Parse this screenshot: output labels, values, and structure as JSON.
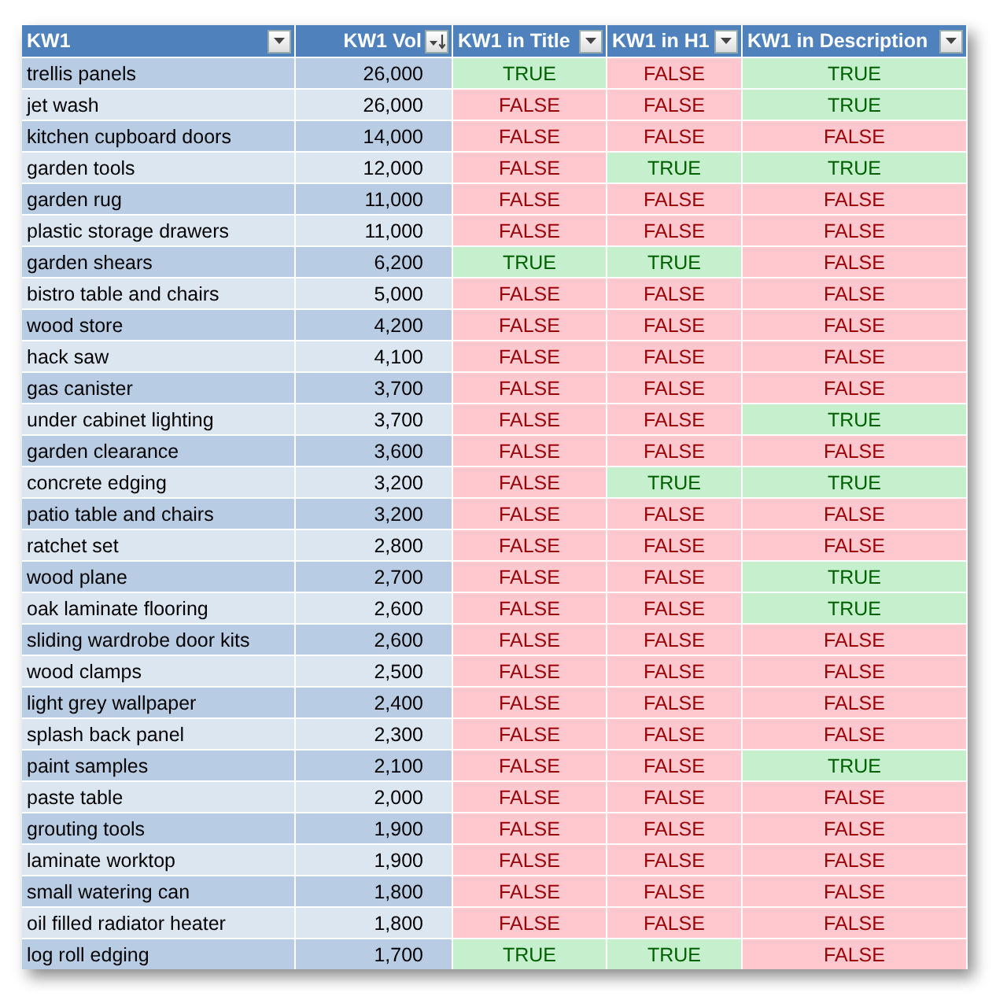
{
  "table": {
    "columns": [
      {
        "label": "KW1",
        "kind": "filter"
      },
      {
        "label": "KW1 Vol",
        "kind": "sorted"
      },
      {
        "label": "KW1 in Title",
        "kind": "filter"
      },
      {
        "label": "KW1 in H1",
        "kind": "filter"
      },
      {
        "label": "KW1 in Description",
        "kind": "filter"
      }
    ],
    "rows": [
      {
        "kw": "trellis panels",
        "vol": "26,000",
        "checks": [
          {
            "text": "TRUE",
            "match": true
          },
          {
            "text": "FALSE",
            "match": false
          },
          {
            "text": "TRUE",
            "match": true
          }
        ]
      },
      {
        "kw": "jet wash",
        "vol": "26,000",
        "checks": [
          {
            "text": "FALSE",
            "match": false
          },
          {
            "text": "FALSE",
            "match": false
          },
          {
            "text": "TRUE",
            "match": true
          }
        ]
      },
      {
        "kw": "kitchen cupboard doors",
        "vol": "14,000",
        "checks": [
          {
            "text": "FALSE",
            "match": false
          },
          {
            "text": "FALSE",
            "match": false
          },
          {
            "text": "FALSE",
            "match": false
          }
        ]
      },
      {
        "kw": "garden tools",
        "vol": "12,000",
        "checks": [
          {
            "text": "FALSE",
            "match": false
          },
          {
            "text": "TRUE",
            "match": true
          },
          {
            "text": "TRUE",
            "match": true
          }
        ]
      },
      {
        "kw": "garden rug",
        "vol": "11,000",
        "checks": [
          {
            "text": "FALSE",
            "match": false
          },
          {
            "text": "FALSE",
            "match": false
          },
          {
            "text": "FALSE",
            "match": false
          }
        ]
      },
      {
        "kw": "plastic storage drawers",
        "vol": "11,000",
        "checks": [
          {
            "text": "FALSE",
            "match": false
          },
          {
            "text": "FALSE",
            "match": false
          },
          {
            "text": "FALSE",
            "match": false
          }
        ]
      },
      {
        "kw": "garden shears",
        "vol": "6,200",
        "checks": [
          {
            "text": "TRUE",
            "match": true
          },
          {
            "text": "TRUE",
            "match": true
          },
          {
            "text": "FALSE",
            "match": false
          }
        ]
      },
      {
        "kw": "bistro table and chairs",
        "vol": "5,000",
        "checks": [
          {
            "text": "FALSE",
            "match": false
          },
          {
            "text": "FALSE",
            "match": false
          },
          {
            "text": "FALSE",
            "match": false
          }
        ]
      },
      {
        "kw": "wood store",
        "vol": "4,200",
        "checks": [
          {
            "text": "FALSE",
            "match": false
          },
          {
            "text": "FALSE",
            "match": false
          },
          {
            "text": "FALSE",
            "match": false
          }
        ]
      },
      {
        "kw": "hack saw",
        "vol": "4,100",
        "checks": [
          {
            "text": "FALSE",
            "match": false
          },
          {
            "text": "FALSE",
            "match": false
          },
          {
            "text": "FALSE",
            "match": false
          }
        ]
      },
      {
        "kw": "gas canister",
        "vol": "3,700",
        "checks": [
          {
            "text": "FALSE",
            "match": false
          },
          {
            "text": "FALSE",
            "match": false
          },
          {
            "text": "FALSE",
            "match": false
          }
        ]
      },
      {
        "kw": "under cabinet lighting",
        "vol": "3,700",
        "checks": [
          {
            "text": "FALSE",
            "match": false
          },
          {
            "text": "FALSE",
            "match": false
          },
          {
            "text": "TRUE",
            "match": true
          }
        ]
      },
      {
        "kw": "garden clearance",
        "vol": "3,600",
        "checks": [
          {
            "text": "FALSE",
            "match": false
          },
          {
            "text": "FALSE",
            "match": false
          },
          {
            "text": "FALSE",
            "match": false
          }
        ]
      },
      {
        "kw": "concrete edging",
        "vol": "3,200",
        "checks": [
          {
            "text": "FALSE",
            "match": false
          },
          {
            "text": "TRUE",
            "match": true
          },
          {
            "text": "TRUE",
            "match": true
          }
        ]
      },
      {
        "kw": "patio table and chairs",
        "vol": "3,200",
        "checks": [
          {
            "text": "FALSE",
            "match": false
          },
          {
            "text": "FALSE",
            "match": false
          },
          {
            "text": "FALSE",
            "match": false
          }
        ]
      },
      {
        "kw": "ratchet set",
        "vol": "2,800",
        "checks": [
          {
            "text": "FALSE",
            "match": false
          },
          {
            "text": "FALSE",
            "match": false
          },
          {
            "text": "FALSE",
            "match": false
          }
        ]
      },
      {
        "kw": "wood plane",
        "vol": "2,700",
        "checks": [
          {
            "text": "FALSE",
            "match": false
          },
          {
            "text": "FALSE",
            "match": false
          },
          {
            "text": "TRUE",
            "match": true
          }
        ]
      },
      {
        "kw": "oak laminate flooring",
        "vol": "2,600",
        "checks": [
          {
            "text": "FALSE",
            "match": false
          },
          {
            "text": "FALSE",
            "match": false
          },
          {
            "text": "TRUE",
            "match": true
          }
        ]
      },
      {
        "kw": "sliding wardrobe door kits",
        "vol": "2,600",
        "checks": [
          {
            "text": "FALSE",
            "match": false
          },
          {
            "text": "FALSE",
            "match": false
          },
          {
            "text": "FALSE",
            "match": false
          }
        ]
      },
      {
        "kw": "wood clamps",
        "vol": "2,500",
        "checks": [
          {
            "text": "FALSE",
            "match": false
          },
          {
            "text": "FALSE",
            "match": false
          },
          {
            "text": "FALSE",
            "match": false
          }
        ]
      },
      {
        "kw": "light grey wallpaper",
        "vol": "2,400",
        "checks": [
          {
            "text": "FALSE",
            "match": false
          },
          {
            "text": "FALSE",
            "match": false
          },
          {
            "text": "FALSE",
            "match": false
          }
        ]
      },
      {
        "kw": "splash back panel",
        "vol": "2,300",
        "checks": [
          {
            "text": "FALSE",
            "match": false
          },
          {
            "text": "FALSE",
            "match": false
          },
          {
            "text": "FALSE",
            "match": false
          }
        ]
      },
      {
        "kw": "paint samples",
        "vol": "2,100",
        "checks": [
          {
            "text": "FALSE",
            "match": false
          },
          {
            "text": "FALSE",
            "match": false
          },
          {
            "text": "TRUE",
            "match": true
          }
        ]
      },
      {
        "kw": "paste table",
        "vol": "2,000",
        "checks": [
          {
            "text": "FALSE",
            "match": false
          },
          {
            "text": "FALSE",
            "match": false
          },
          {
            "text": "FALSE",
            "match": false
          }
        ]
      },
      {
        "kw": "grouting tools",
        "vol": "1,900",
        "checks": [
          {
            "text": "FALSE",
            "match": false
          },
          {
            "text": "FALSE",
            "match": false
          },
          {
            "text": "FALSE",
            "match": false
          }
        ]
      },
      {
        "kw": "laminate worktop",
        "vol": "1,900",
        "checks": [
          {
            "text": "FALSE",
            "match": false
          },
          {
            "text": "FALSE",
            "match": false
          },
          {
            "text": "FALSE",
            "match": false
          }
        ]
      },
      {
        "kw": "small watering can",
        "vol": "1,800",
        "checks": [
          {
            "text": "FALSE",
            "match": false
          },
          {
            "text": "FALSE",
            "match": false
          },
          {
            "text": "FALSE",
            "match": false
          }
        ]
      },
      {
        "kw": "oil filled radiator heater",
        "vol": "1,800",
        "checks": [
          {
            "text": "FALSE",
            "match": false
          },
          {
            "text": "FALSE",
            "match": false
          },
          {
            "text": "FALSE",
            "match": false
          }
        ]
      },
      {
        "kw": "log roll edging",
        "vol": "1,700",
        "checks": [
          {
            "text": "TRUE",
            "match": true
          },
          {
            "text": "TRUE",
            "match": true
          },
          {
            "text": "FALSE",
            "match": false
          }
        ]
      }
    ]
  }
}
